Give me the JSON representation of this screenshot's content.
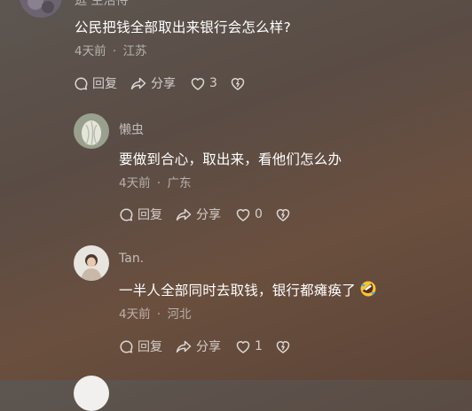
{
  "top_user": {
    "name": "逛 生活待"
  },
  "comments": [
    {
      "name": "",
      "content": "公民把钱全部取出来银行会怎么样?",
      "time": "4天前",
      "location": "江苏",
      "reply_label": "回复",
      "share_label": "分享",
      "likes": "3"
    },
    {
      "name": "懒虫",
      "content": "要做到合心，取出来，看他们怎么办",
      "time": "4天前",
      "location": "广东",
      "reply_label": "回复",
      "share_label": "分享",
      "likes": "0"
    },
    {
      "name": "Tan.",
      "content": "一半人全部同时去取钱，银行都瘫痪了",
      "emoji": "rolling-on-floor-laughing",
      "time": "4天前",
      "location": "河北",
      "reply_label": "回复",
      "share_label": "分享",
      "likes": "1"
    }
  ],
  "meta_separator": "·",
  "icons": [
    "comment-icon",
    "share-icon",
    "heart-icon",
    "dislike-heart-icon"
  ],
  "colors": {
    "background": "#5c4c44",
    "text": "#ffffff",
    "secondary": "#b8ada6"
  }
}
